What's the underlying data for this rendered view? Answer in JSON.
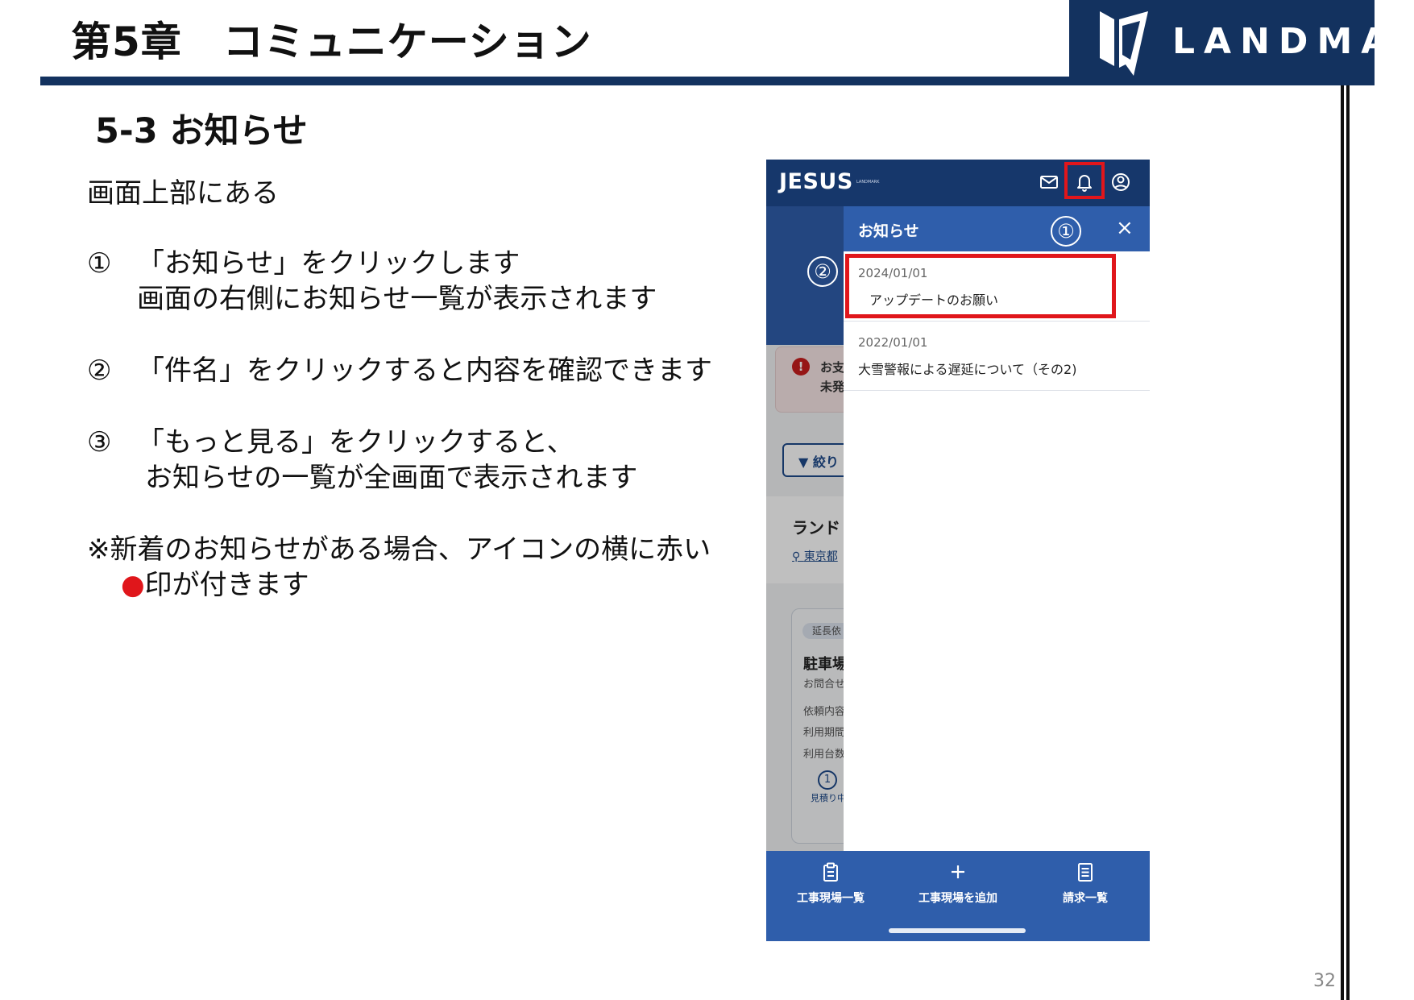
{
  "header": {
    "chapter_title": "第5章　コミュニケーション",
    "logo_text": "LANDMARK"
  },
  "section": {
    "title": "5-3 お知らせ"
  },
  "instructions": {
    "intro": "画面上部にある",
    "steps": [
      {
        "num": "①",
        "line1": "「お知らせ」をクリックします",
        "line2": "画面の右側にお知らせ一覧が表示されます"
      },
      {
        "num": "②",
        "line1": "「件名」をクリックすると内容を確認できます",
        "line2": ""
      },
      {
        "num": "③",
        "line1": "「もっと見る」をクリックすると、",
        "line2": "お知らせの一覧が全画面で表示されます"
      }
    ],
    "note_line1": "※新着のお知らせがある場合、アイコンの横に赤い",
    "note_dot": "●",
    "note_line2": "印が付きます"
  },
  "page_number": "32",
  "phone": {
    "app_name": "JESUS",
    "app_name_small": "LANDMARK",
    "appbar_icons": [
      "mail-icon",
      "bell-icon",
      "account-icon"
    ],
    "notifications": {
      "title": "お知らせ",
      "close_label": "×",
      "items": [
        {
          "date": "2024/01/01",
          "subject": "アップデートのお願い"
        },
        {
          "date": "2022/01/01",
          "subject": "大雪警報による遅延について（その2)"
        }
      ]
    },
    "callouts": [
      "①",
      "②"
    ],
    "background": {
      "alert_icon": "!",
      "alert_text_1": "お支",
      "alert_text_2": "未発",
      "filter_label": "絞り",
      "land_title": "ランド",
      "address": "東京都",
      "card_tag": "延長依",
      "card_title": "駐車場",
      "card_line1": "お問合せ",
      "card_line2": "依頼内容",
      "card_line3": "利用期間",
      "card_line4": "利用台数",
      "card_step": "1",
      "card_status": "見積り中"
    },
    "bottom_nav": [
      {
        "label": "工事現場一覧",
        "icon": "clipboard-icon"
      },
      {
        "label": "工事現場を追加",
        "icon": "plus-icon"
      },
      {
        "label": "請求一覧",
        "icon": "list-icon"
      }
    ]
  },
  "colors": {
    "navy": "#13325f",
    "app_blue": "#2f5eab",
    "highlight_red": "#e0161b"
  }
}
